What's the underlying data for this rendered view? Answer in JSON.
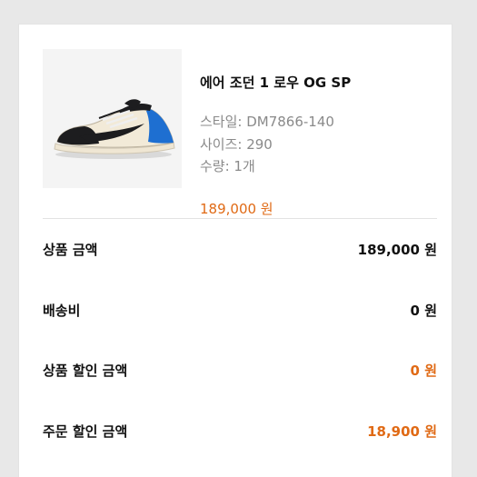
{
  "product": {
    "name": "에어 조던 1 로우 OG SP",
    "style": "스타일: DM7866-140",
    "size": "사이즈: 290",
    "quantity": "수량: 1개",
    "price": "189,000 원",
    "image_icon": "sneaker-image"
  },
  "summary": [
    {
      "label": "상품 금액",
      "value": "189,000 원"
    },
    {
      "label": "배송비",
      "value": "0 원"
    },
    {
      "label": "상품 할인 금액",
      "value": "0 원"
    },
    {
      "label": "주문 할인 금액",
      "value": "18,900 원"
    }
  ],
  "colors": {
    "accent": "#e06a15",
    "text": "#111111",
    "muted": "#8a8a8a",
    "background": "#e8e8e8"
  }
}
